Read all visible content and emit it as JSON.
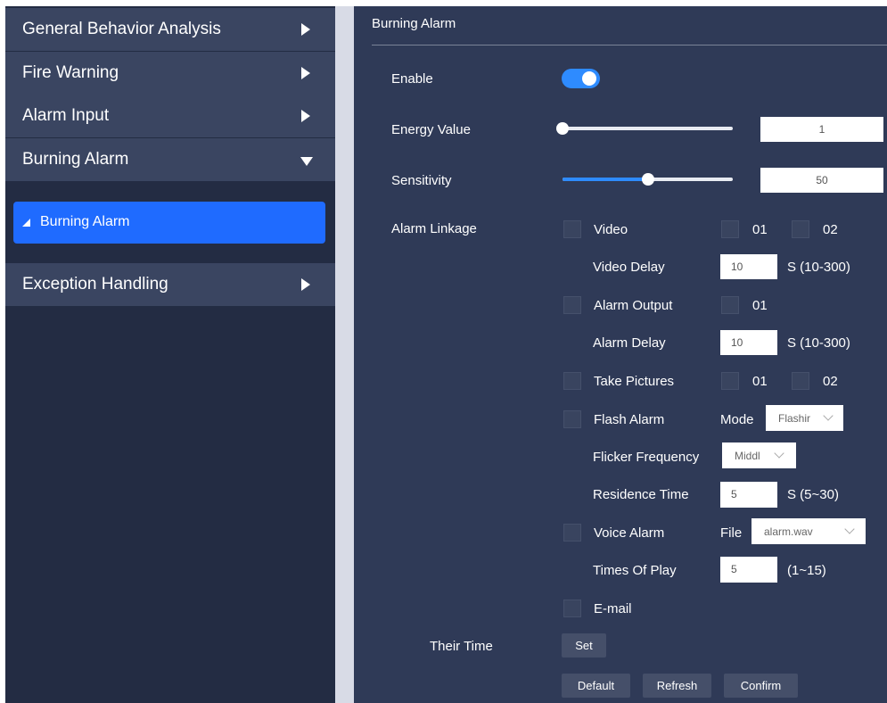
{
  "sidebar": {
    "items": [
      {
        "label": "General Behavior Analysis"
      },
      {
        "label": "Fire Warning"
      },
      {
        "label": "Alarm Input"
      },
      {
        "label": "Burning Alarm"
      },
      {
        "label": "Exception Handling"
      }
    ],
    "active_sub_item": "Burning Alarm"
  },
  "panel": {
    "title": "Burning Alarm",
    "enable": {
      "label": "Enable",
      "value": true
    },
    "energy": {
      "label": "Energy Value",
      "value": "1",
      "slider_fraction": 0.0
    },
    "sensitivity": {
      "label": "Sensitivity",
      "value": "50",
      "slider_fraction": 0.5
    },
    "linkage": {
      "label": "Alarm Linkage",
      "video": {
        "label": "Video",
        "ch1": "01",
        "ch2": "02"
      },
      "video_delay": {
        "label": "Video Delay",
        "value": "10",
        "unit": "S  (10-300)"
      },
      "alarm_output": {
        "label": "Alarm Output",
        "ch1": "01"
      },
      "alarm_delay": {
        "label": "Alarm Delay",
        "value": "10",
        "unit": "S  (10-300)"
      },
      "take_pictures": {
        "label": "Take Pictures",
        "ch1": "01",
        "ch2": "02"
      },
      "flash_alarm": {
        "label": "Flash Alarm",
        "mode_label": "Mode",
        "mode_value": "Flashir"
      },
      "flicker": {
        "label": "Flicker Frequency",
        "value": "Middl"
      },
      "residence": {
        "label": "Residence Time",
        "value": "5",
        "unit": "S (5~30)"
      },
      "voice_alarm": {
        "label": "Voice Alarm",
        "file_label": "File",
        "file_value": "alarm.wav"
      },
      "times_of_play": {
        "label": "Times Of Play",
        "value": "5",
        "unit": "(1~15)"
      },
      "email": {
        "label": "E-mail"
      }
    },
    "their_time": {
      "label": "Their Time",
      "button": "Set"
    },
    "buttons": {
      "default": "Default",
      "refresh": "Refresh",
      "confirm": "Confirm"
    }
  },
  "colors": {
    "accent": "#2e8bff",
    "active_menu": "#1f6bff",
    "panel_bg": "#2f3a57",
    "sidebar_bg": "#232c43"
  }
}
